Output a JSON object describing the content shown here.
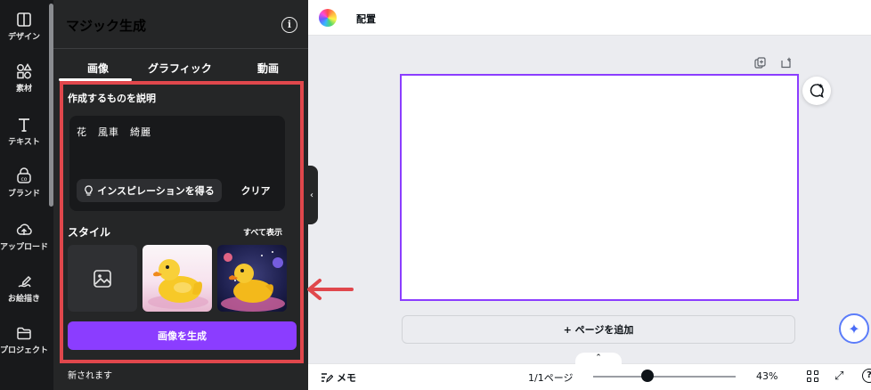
{
  "rail": {
    "items": [
      {
        "label": "デザイン",
        "icon": "layout-icon"
      },
      {
        "label": "素材",
        "icon": "shapes-icon"
      },
      {
        "label": "テキスト",
        "icon": "text-icon"
      },
      {
        "label": "ブランド",
        "icon": "brand-icon"
      },
      {
        "label": "アップロード",
        "icon": "upload-cloud-icon"
      },
      {
        "label": "お絵描き",
        "icon": "draw-icon"
      },
      {
        "label": "プロジェクト",
        "icon": "folder-icon"
      }
    ]
  },
  "panel": {
    "title": "マジック生成",
    "info_icon": "i",
    "tabs": [
      "画像",
      "グラフィック",
      "動画"
    ],
    "active_tab": "画像",
    "describe_label": "作成するものを説明",
    "prompt_text": "花　風車　綺麗",
    "inspiration_button": "インスピレーションを得る",
    "clear_button": "クリア",
    "style_label": "スタイル",
    "show_all": "すべて表示",
    "generate_button": "画像を生成",
    "updated_text": "新されます"
  },
  "topbar": {
    "arrange_label": "配置"
  },
  "canvas": {
    "add_page_label": "+ ページを追加"
  },
  "bottombar": {
    "notes_label": "メモ",
    "pages_label": "1/1ページ",
    "zoom_label": "43%",
    "zoom_percent": 43,
    "help_glyph": "?"
  },
  "colors": {
    "accent": "#8b3dff",
    "highlight": "#e0474c",
    "panel_bg": "#252627"
  }
}
